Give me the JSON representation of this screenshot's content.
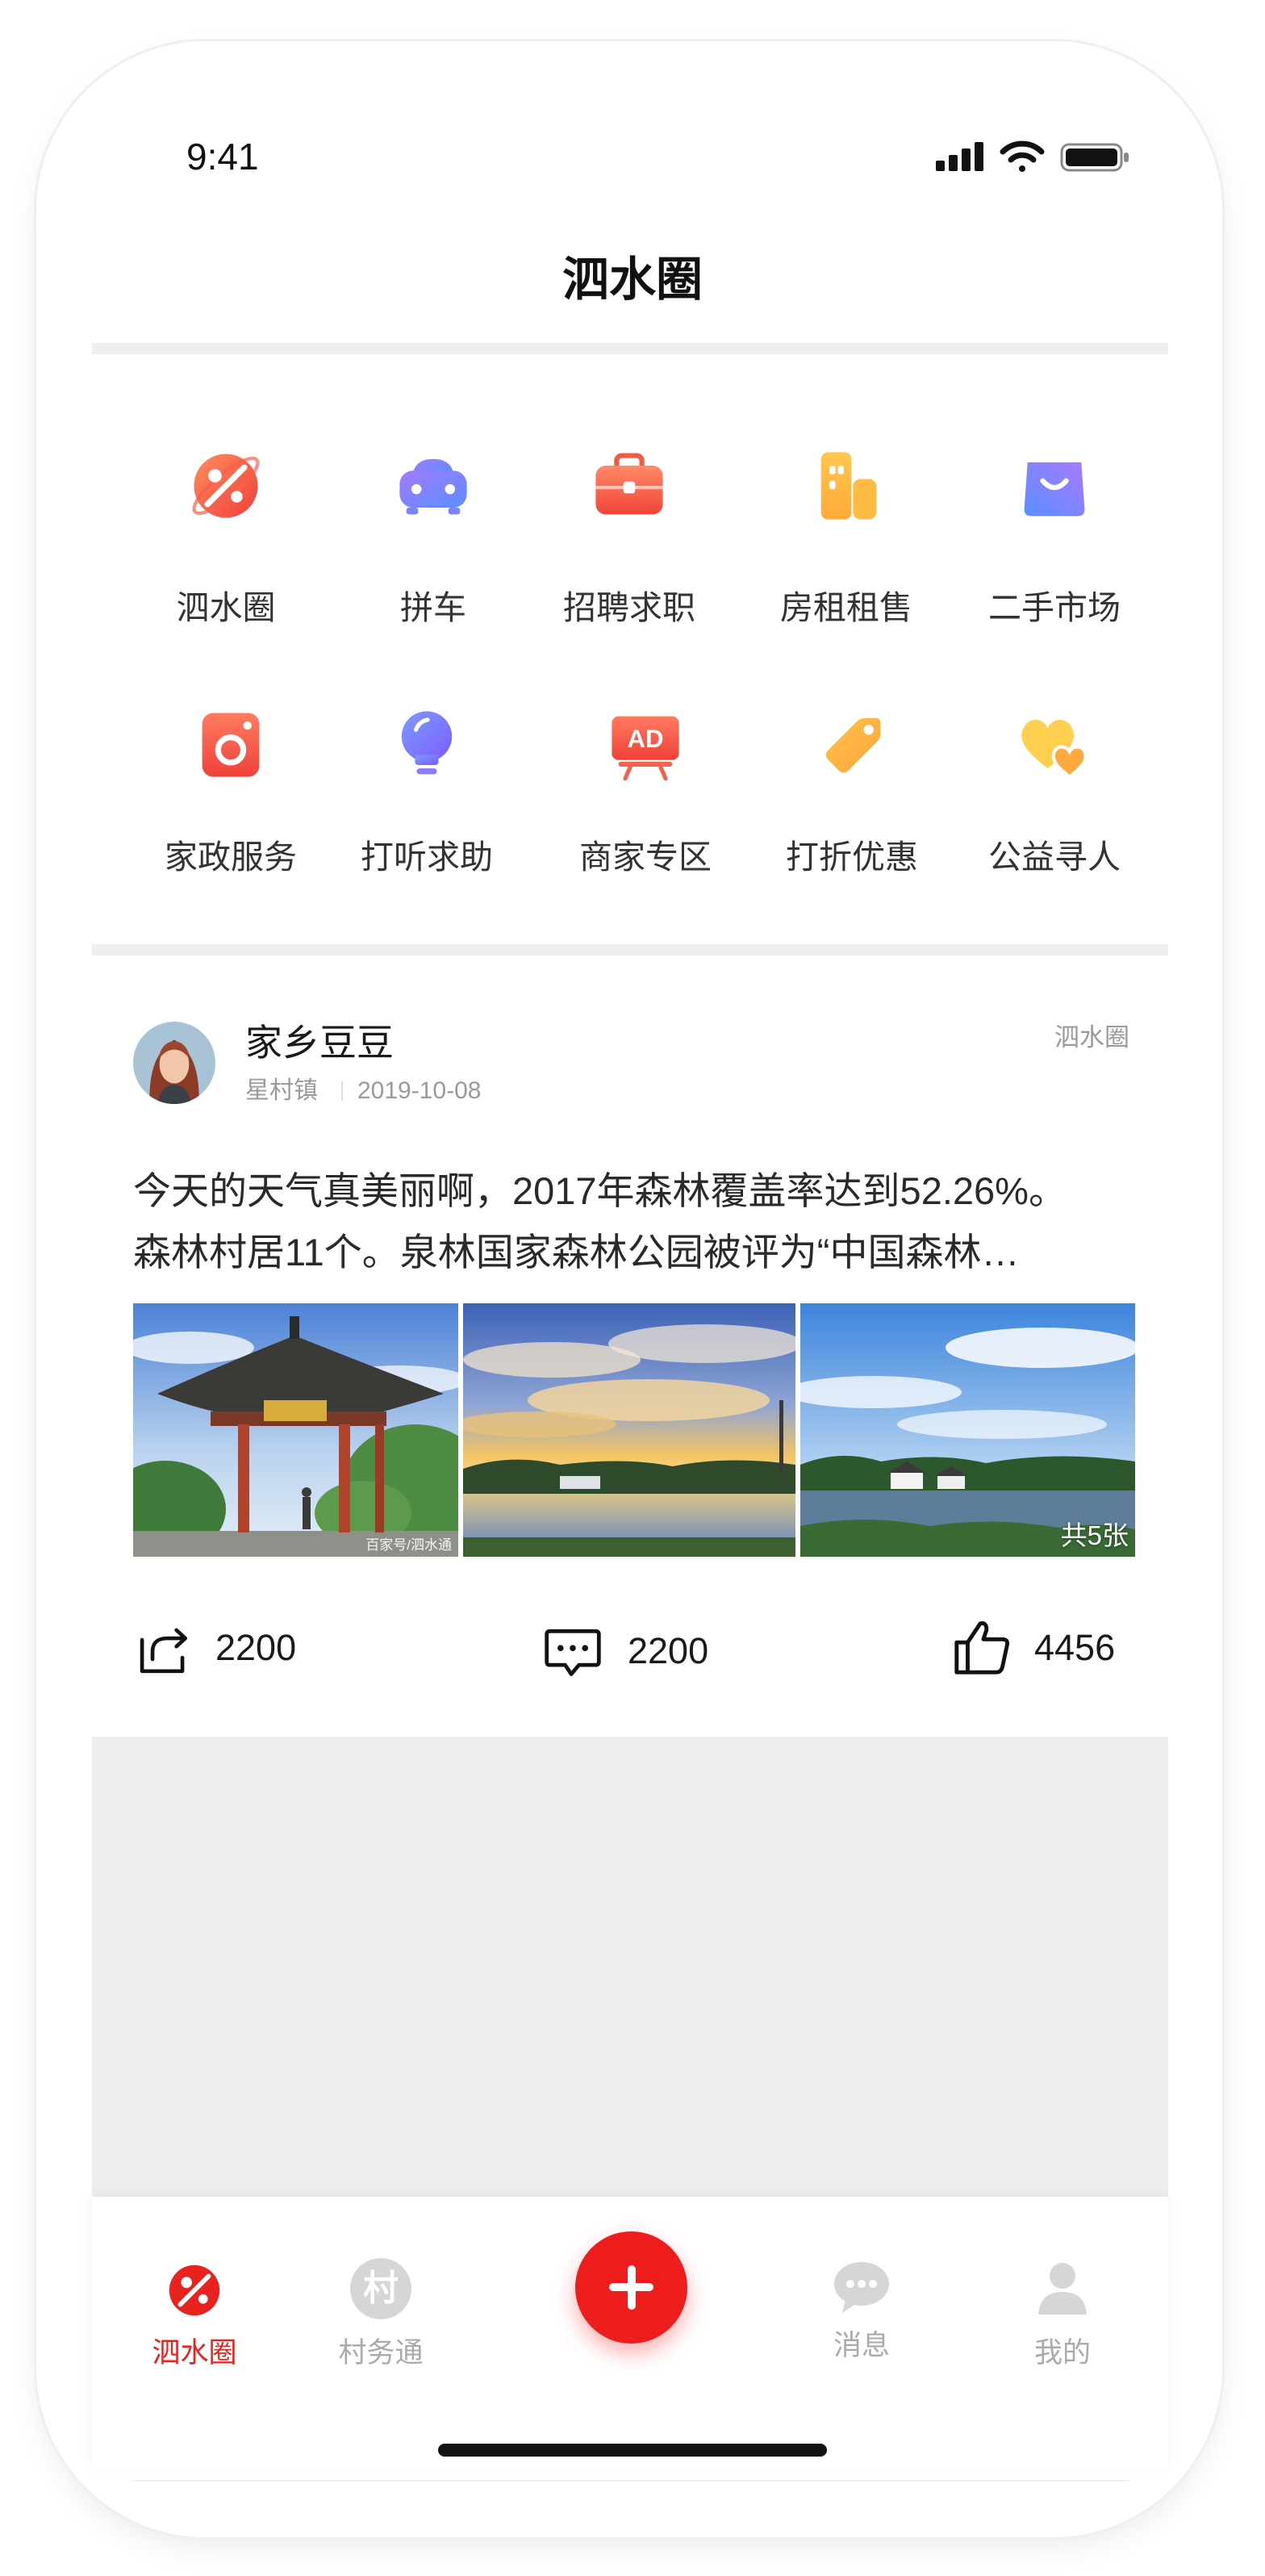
{
  "status_bar": {
    "time": "9:41",
    "icons": [
      "signal-icon",
      "wifi-icon",
      "battery-icon"
    ]
  },
  "header": {
    "title": "泗水圈"
  },
  "categories": [
    {
      "label": "泗水圈",
      "icon": "planet-icon"
    },
    {
      "label": "拼车",
      "icon": "car-icon"
    },
    {
      "label": "招聘求职",
      "icon": "briefcase-icon"
    },
    {
      "label": "房租租售",
      "icon": "buildings-icon"
    },
    {
      "label": "二手市场",
      "icon": "shopping-bag-icon"
    },
    {
      "label": "家政服务",
      "icon": "washing-machine-icon"
    },
    {
      "label": "打听求助",
      "icon": "lightbulb-icon"
    },
    {
      "label": "商家专区",
      "icon": "ad-board-icon",
      "icon_text": "AD"
    },
    {
      "label": "打折优惠",
      "icon": "price-tag-icon"
    },
    {
      "label": "公益寻人",
      "icon": "hearts-icon"
    }
  ],
  "post": {
    "author": "家乡豆豆",
    "location": "星村镇",
    "date": "2019-10-08",
    "channel": "泗水圈",
    "text_lines": [
      "今天的天气真美丽啊，2017年森林覆盖率达到52.26%。",
      "森林村居11个。泉林国家森林公园被评为“中国森林…"
    ],
    "images": [
      {
        "icon": "pavilion-photo",
        "watermark": "百家号/泗水通"
      },
      {
        "icon": "sunset-lake-photo"
      },
      {
        "icon": "lakeside-village-photo"
      }
    ],
    "image_count_label": "共5张",
    "stats": {
      "shares": "2200",
      "comments": "2200",
      "likes": "4456"
    }
  },
  "tab_bar": {
    "items": [
      {
        "label": "泗水圈",
        "icon": "planet-icon",
        "active": true
      },
      {
        "label": "村务通",
        "icon": "village-icon",
        "icon_text": "村",
        "active": false
      },
      {
        "icon": "plus-icon",
        "active": false
      },
      {
        "label": "消息",
        "icon": "chat-bubble-icon",
        "active": false
      },
      {
        "label": "我的",
        "icon": "person-icon",
        "active": false
      }
    ]
  },
  "colors": {
    "accent": "#e8231f",
    "divider": "#efefef",
    "text": "#222222",
    "muted": "#9a9a9a"
  }
}
